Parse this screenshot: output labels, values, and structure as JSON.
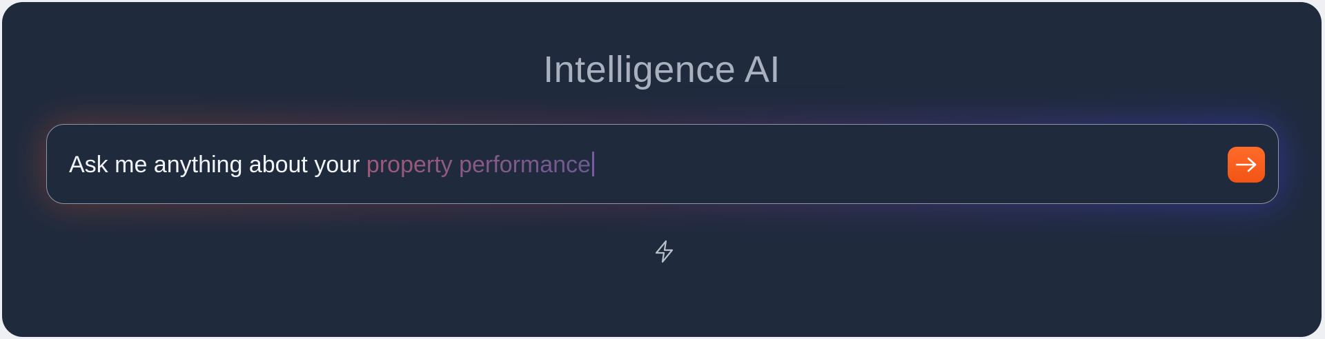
{
  "header": {
    "title": "Intelligence AI"
  },
  "search": {
    "value_prefix": "Ask me anything about your ",
    "value_highlight": "property performance",
    "send_icon": "arrow-right-icon"
  },
  "actions": {
    "quick_icon": "lightning-icon"
  },
  "colors": {
    "panel_background": "#1f2a3d",
    "accent": "#ff5f1f",
    "title_text": "#a9b1be",
    "highlight_start": "#a25978",
    "highlight_end": "#6e5a95"
  }
}
